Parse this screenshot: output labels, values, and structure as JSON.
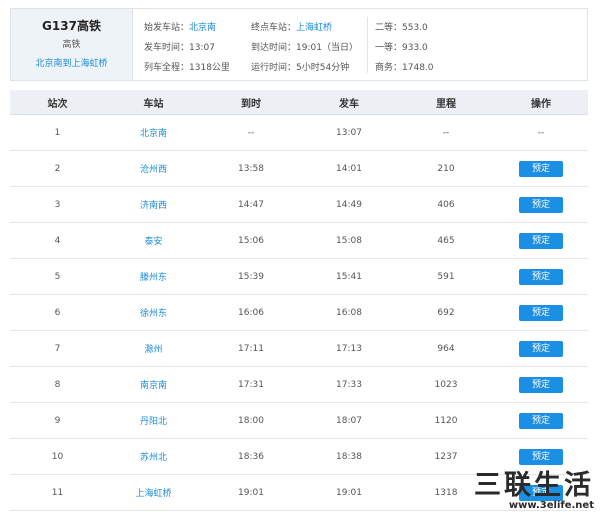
{
  "train": {
    "number": "G137高铁",
    "type": "高铁",
    "route": "北京南到上海虹桥",
    "start_label": "始发车站：",
    "start_value": "北京南",
    "end_label": "终点车站：",
    "end_value": "上海虹桥",
    "depart_label": "发车时间：",
    "depart_value": "13:07",
    "arrive_label": "到达时间：",
    "arrive_value": "19:01（当日）",
    "distance_label": "列车全程：",
    "distance_value": "1318公里",
    "duration_label": "运行时间：",
    "duration_value": "5小时54分钟",
    "prices": [
      {
        "label": "二等：",
        "value": "553.0"
      },
      {
        "label": "一等：",
        "value": "933.0"
      },
      {
        "label": "商务：",
        "value": "1748.0"
      }
    ]
  },
  "table": {
    "headers": [
      "站次",
      "车站",
      "到时",
      "发车",
      "里程",
      "操作"
    ],
    "book_label": "预定",
    "rows": [
      {
        "no": "1",
        "station": "北京南",
        "arrive": "--",
        "depart": "13:07",
        "distance": "--",
        "op": "--"
      },
      {
        "no": "2",
        "station": "沧州西",
        "arrive": "13:58",
        "depart": "14:01",
        "distance": "210",
        "op": "预定"
      },
      {
        "no": "3",
        "station": "济南西",
        "arrive": "14:47",
        "depart": "14:49",
        "distance": "406",
        "op": "预定"
      },
      {
        "no": "4",
        "station": "泰安",
        "arrive": "15:06",
        "depart": "15:08",
        "distance": "465",
        "op": "预定"
      },
      {
        "no": "5",
        "station": "滕州东",
        "arrive": "15:39",
        "depart": "15:41",
        "distance": "591",
        "op": "预定"
      },
      {
        "no": "6",
        "station": "徐州东",
        "arrive": "16:06",
        "depart": "16:08",
        "distance": "692",
        "op": "预定"
      },
      {
        "no": "7",
        "station": "滁州",
        "arrive": "17:11",
        "depart": "17:13",
        "distance": "964",
        "op": "预定"
      },
      {
        "no": "8",
        "station": "南京南",
        "arrive": "17:31",
        "depart": "17:33",
        "distance": "1023",
        "op": "预定"
      },
      {
        "no": "9",
        "station": "丹阳北",
        "arrive": "18:00",
        "depart": "18:07",
        "distance": "1120",
        "op": "预定"
      },
      {
        "no": "10",
        "station": "苏州北",
        "arrive": "18:36",
        "depart": "18:38",
        "distance": "1237",
        "op": "预定"
      },
      {
        "no": "11",
        "station": "上海虹桥",
        "arrive": "19:01",
        "depart": "19:01",
        "distance": "1318",
        "op": "预定"
      }
    ]
  },
  "watermark": {
    "main": "三联生活",
    "url": "www.3elife.net"
  }
}
